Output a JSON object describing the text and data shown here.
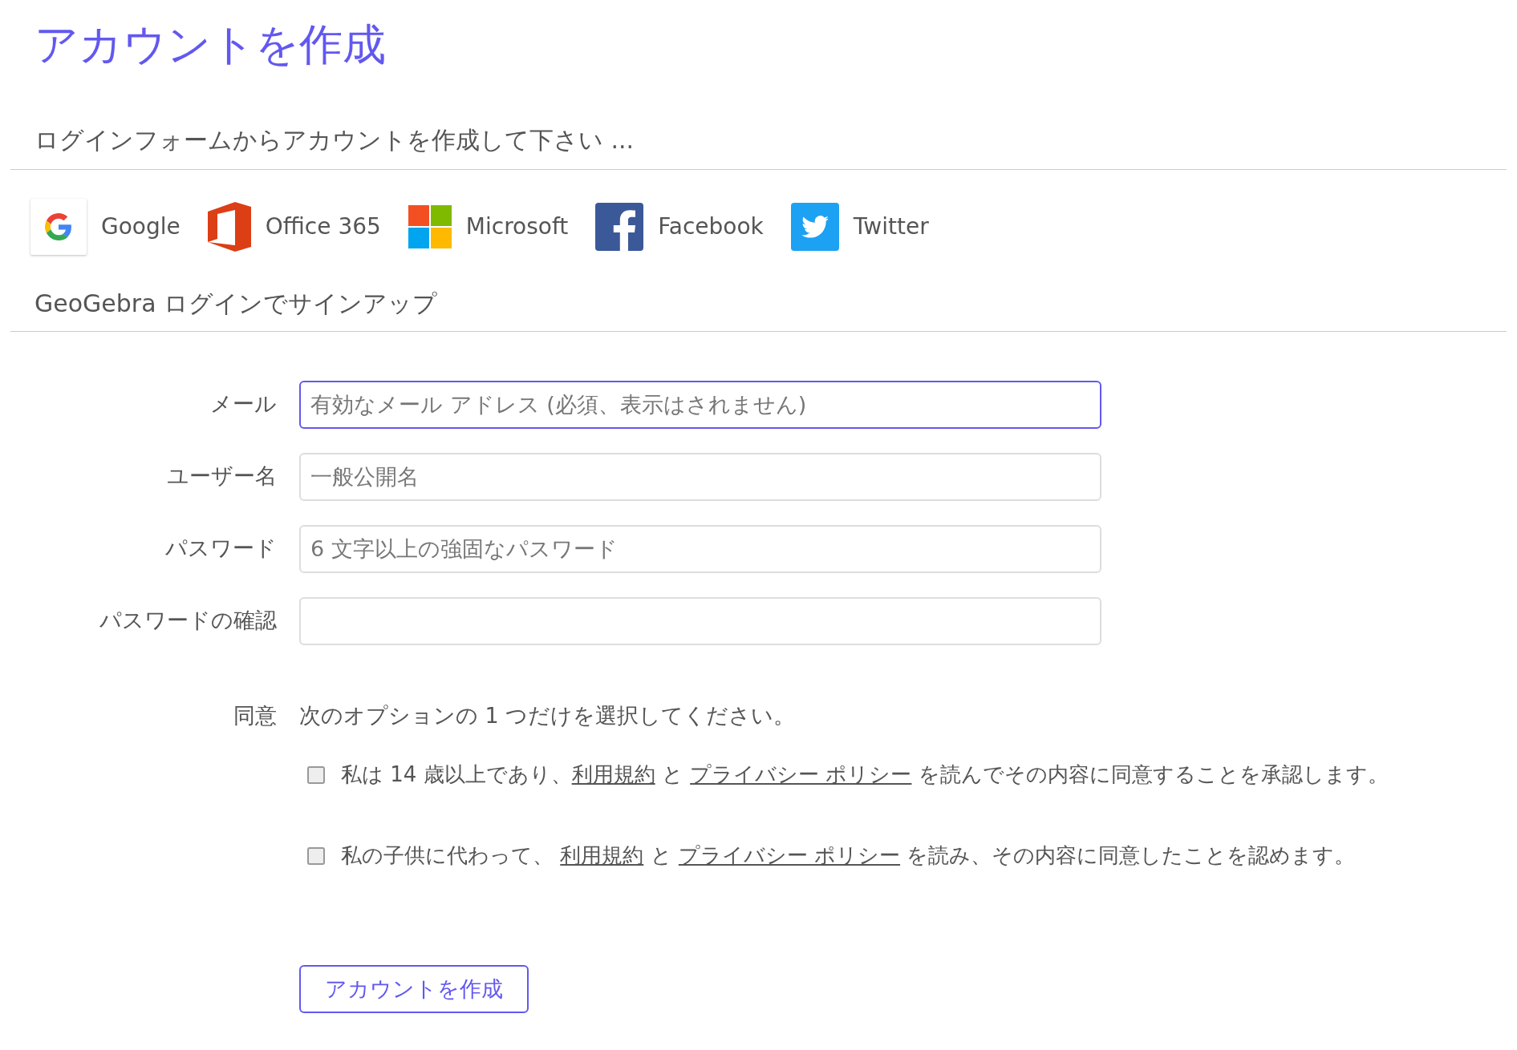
{
  "title": "アカウントを作成",
  "social_heading": "ログインフォームからアカウントを作成して下さい ...",
  "providers": [
    {
      "kind": "google",
      "label": "Google"
    },
    {
      "kind": "office",
      "label": "Office 365"
    },
    {
      "kind": "microsoft",
      "label": "Microsoft"
    },
    {
      "kind": "facebook",
      "label": "Facebook"
    },
    {
      "kind": "twitter",
      "label": "Twitter"
    }
  ],
  "signup_heading": "GeoGebra ログインでサインアップ",
  "fields": [
    {
      "label": "メール",
      "placeholder": "有効なメール アドレス (必須、表示はされません)",
      "focused": true
    },
    {
      "label": "ユーザー名",
      "placeholder": "一般公開名",
      "focused": false
    },
    {
      "label": "パスワード",
      "placeholder": "6 文字以上の強固なパスワード",
      "focused": false
    },
    {
      "label": "パスワードの確認",
      "focused": false
    }
  ],
  "consent": {
    "label": "同意",
    "instruction": "次のオプションの 1 つだけを選択してください。",
    "options": [
      {
        "checked": false,
        "parts": [
          {
            "kind": "text",
            "text": "私は 14 歳以上であり、"
          },
          {
            "kind": "link",
            "text": "利用規約"
          },
          {
            "kind": "text",
            "text": " と "
          },
          {
            "kind": "link",
            "text": "プライバシー ポリシー"
          },
          {
            "kind": "text",
            "text": " を読んでその内容に同意することを承認します。"
          }
        ]
      },
      {
        "checked": false,
        "parts": [
          {
            "kind": "text",
            "text": "私の子供に代わって、 "
          },
          {
            "kind": "link",
            "text": "利用規約"
          },
          {
            "kind": "text",
            "text": " と "
          },
          {
            "kind": "link",
            "text": "プライバシー ポリシー"
          },
          {
            "kind": "text",
            "text": " を読み、その内容に同意したことを認めます。"
          }
        ]
      }
    ]
  },
  "submit": "アカウントを作成"
}
